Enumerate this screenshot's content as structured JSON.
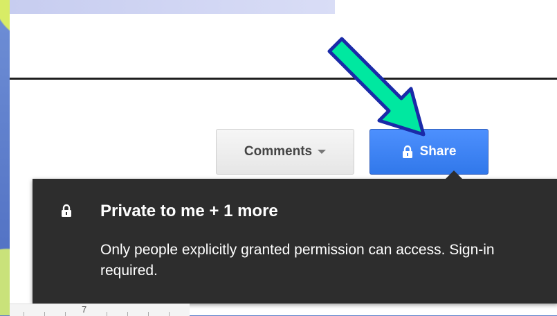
{
  "toolbar": {
    "comments_label": "Comments",
    "share_label": "Share"
  },
  "share_tooltip": {
    "title": "Private to me + 1 more",
    "description": "Only people explicitly granted permission can access. Sign-in required."
  },
  "ruler": {
    "visible_number": "7"
  },
  "colors": {
    "share_button": "#4d90fe",
    "tooltip_bg": "#2d2d2d",
    "arrow_fill": "#00e8a0",
    "arrow_outline": "#1a2aa8"
  },
  "icons": [
    "lock-icon",
    "caret-down-icon",
    "pointer-arrow"
  ]
}
